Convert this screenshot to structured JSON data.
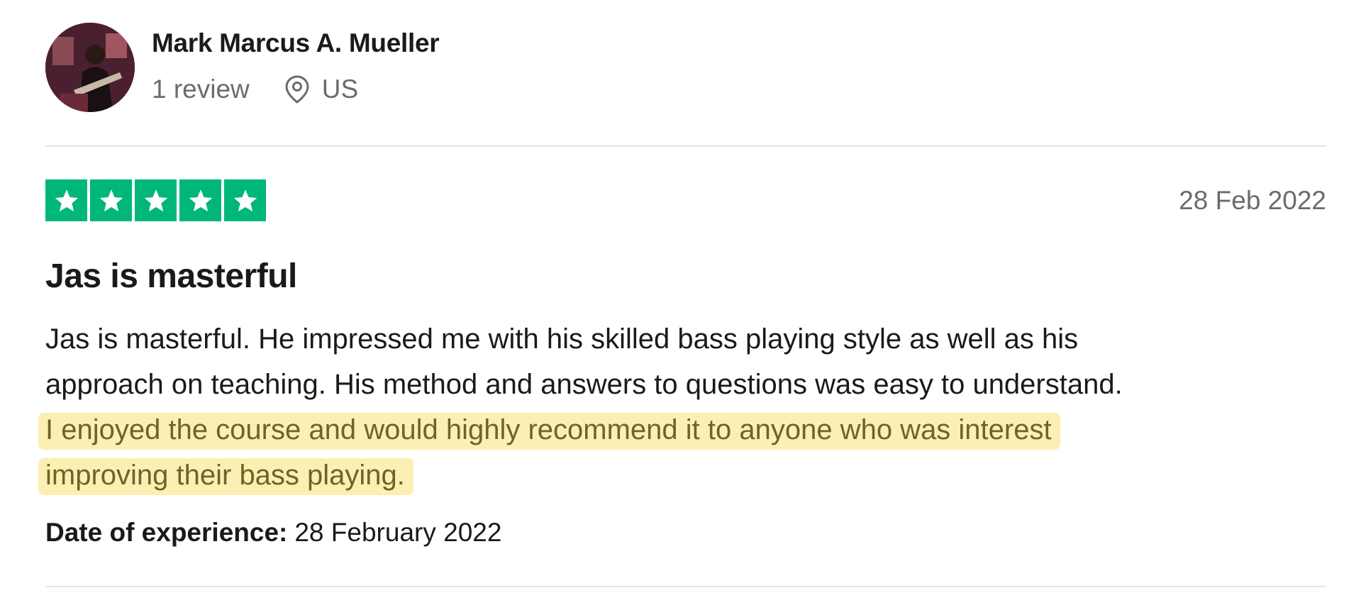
{
  "reviewer": {
    "name": "Mark Marcus A. Mueller",
    "review_count": "1 review",
    "country": "US",
    "avatar_icon": "user-avatar-photo",
    "location_icon": "map-pin-icon"
  },
  "review": {
    "rating": 5,
    "rating_max": 5,
    "star_color": "#00b67a",
    "date": "28 Feb 2022",
    "title": "Jas is masterful",
    "body_lines": [
      "Jas is masterful. He impressed me with his skilled bass playing style as well as his",
      "approach on teaching. His method and answers to questions was easy to understand."
    ],
    "highlighted_lines": [
      "I enjoyed the course and would highly recommend it to anyone who was interest",
      "improving their bass playing."
    ],
    "highlight_color": "#fcefb4",
    "experience_label": "Date of experience:",
    "experience_date": "28 February 2022"
  }
}
